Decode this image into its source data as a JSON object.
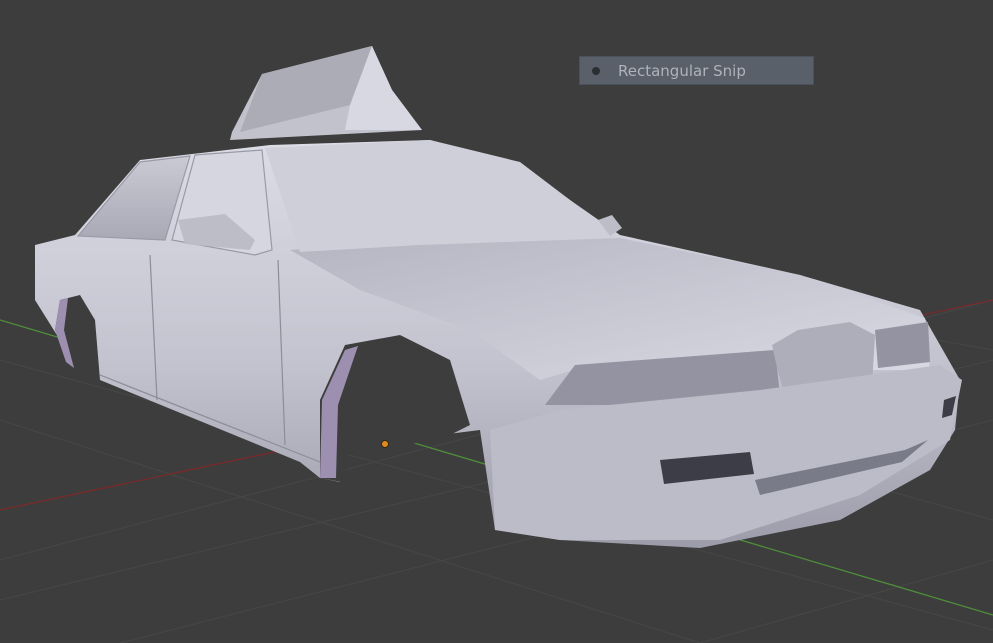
{
  "viewport": {
    "background": "#3d3d3d",
    "x_axis_color": "#8a2a2a",
    "y_axis_color": "#5a9a3a",
    "grid_color": "#474747",
    "model_color": "#c9c9d3"
  },
  "overlay": {
    "tooltip_label": "Rectangular Snip",
    "tooltip_icon": "record-dot-icon"
  },
  "origin_marker_color": "#e08a20"
}
